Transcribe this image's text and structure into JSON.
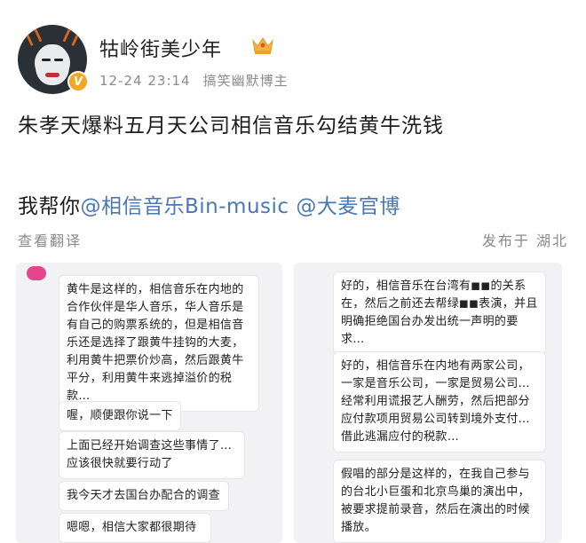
{
  "post": {
    "username": "牯岭街美少年",
    "timestamp": "12-24 23:14",
    "user_tag": "搞笑幽默博主",
    "line1": "朱孝天爆料五月天公司相信音乐勾结黄牛洗钱",
    "line2_prefix": "我帮你",
    "mention1": "@相信音乐Bin-music",
    "mention2": "@大麦官博",
    "translate_label": "查看翻译",
    "location_label": "发布于 湖北",
    "verify_badge": "V",
    "accent_color": "#4a78b5",
    "icons": [
      "avatar",
      "verified-badge-icon",
      "crown-icon"
    ]
  },
  "left_chat": {
    "messages": [
      "黄牛是这样的，相信音乐在内地的合作伙伴是华人音乐，华人音乐是有自己的购票系统的，但是相信音乐还是选择了跟黄牛挂钩的大麦，利用黄牛把票价炒高，然后跟黄牛平分，利用黄牛来逃掉溢价的税款…",
      "喔，顺便跟你说一下",
      "上面已经开始调查这些事情了…应该很快就要行动了",
      "我今天才去国台办配合的调查",
      "嗯嗯，相信大家都很期待"
    ]
  },
  "right_chat": {
    "messages": [
      "好的，相信音乐在台湾有◼◼的关系在，然后之前还去帮绿◼◼表演，并且明确拒绝国台办发出统一声明的要求…",
      "好的，相信音乐在内地有两家公司，一家是音乐公司，一家是贸易公司…经常利用谎报艺人酬劳，然后把部分应付款项用贸易公司转到境外支付…借此逃漏应付的税款…",
      "假唱的部分是这样的，在我自己参与的台北小巨蛋和北京鸟巢的演出中，被要求提前录音，然后在演出的时候播放。"
    ]
  }
}
